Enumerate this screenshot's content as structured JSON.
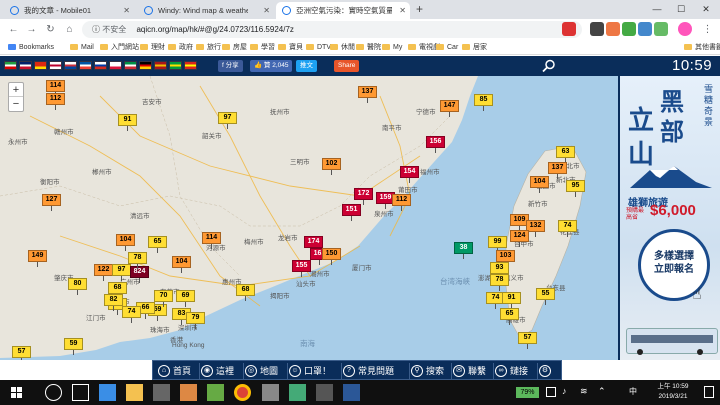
{
  "browser": {
    "tabs": [
      {
        "title": "我的文章 - Mobile01",
        "active": false
      },
      {
        "title": "Windy: Wind map & weather fo",
        "active": false
      },
      {
        "title": "亞洲空氣污染：實時空氣質量指數",
        "active": true
      }
    ],
    "new_tab": "+",
    "window_controls": {
      "minimize": "—",
      "maximize": "☐",
      "close": "✕"
    },
    "insecure_label": "不安全",
    "url": "aqicn.org/map/hk/#@g/24.0723/116.5924/7z"
  },
  "bookmarks": [
    {
      "label": "Bookmarks",
      "kind": "apps"
    },
    {
      "label": "Mail"
    },
    {
      "label": "入門網站"
    },
    {
      "label": "理財"
    },
    {
      "label": "政府"
    },
    {
      "label": "旅行"
    },
    {
      "label": "房屋"
    },
    {
      "label": "學習"
    },
    {
      "label": "寶貝"
    },
    {
      "label": "DTV"
    },
    {
      "label": "休閒"
    },
    {
      "label": "醫院"
    },
    {
      "label": "My"
    },
    {
      "label": "電視劇"
    },
    {
      "label": "Car"
    },
    {
      "label": "居家"
    },
    {
      "label": "其他書籤"
    }
  ],
  "site_header": {
    "flags": [
      {
        "name": "iran-flag",
        "colors": [
          "#239f40",
          "#ffffff",
          "#da0000"
        ]
      },
      {
        "name": "uk-flag",
        "colors": [
          "#012169",
          "#ffffff",
          "#c8102e"
        ]
      },
      {
        "name": "china-flag",
        "colors": [
          "#de2910",
          "#de2910",
          "#ffde00"
        ]
      },
      {
        "name": "japan-flag",
        "colors": [
          "#ffffff",
          "#bc002d",
          "#ffffff"
        ]
      },
      {
        "name": "korea-flag",
        "colors": [
          "#ffffff",
          "#cd2e3a",
          "#0047a0"
        ]
      },
      {
        "name": "france-flag",
        "colors": [
          "#0055a4",
          "#ffffff",
          "#ef4135"
        ]
      },
      {
        "name": "russia-flag",
        "colors": [
          "#ffffff",
          "#0039a6",
          "#d52b1e"
        ]
      },
      {
        "name": "poland-flag",
        "colors": [
          "#ffffff",
          "#ffffff",
          "#dc143c"
        ]
      },
      {
        "name": "italy-flag",
        "colors": [
          "#009246",
          "#ffffff",
          "#ce2b37"
        ]
      },
      {
        "name": "germany-flag",
        "colors": [
          "#000000",
          "#dd0000",
          "#ffce00"
        ]
      },
      {
        "name": "spain-flag",
        "colors": [
          "#aa151b",
          "#f1bf00",
          "#aa151b"
        ]
      },
      {
        "name": "brazil-flag",
        "colors": [
          "#009c3b",
          "#ffdf00",
          "#009c3b"
        ]
      },
      {
        "name": "vietnam-flag",
        "colors": [
          "#da251d",
          "#ffff00",
          "#da251d"
        ]
      }
    ],
    "fb_share": "f 分享",
    "like": "👍 贊 2,045",
    "twitter": "推文",
    "share": "Share",
    "clock": "10:59"
  },
  "map": {
    "zoom_in": "+",
    "zoom_out": "−",
    "city_labels": [
      "永州市",
      "赣州市",
      "韶关市",
      "南平市",
      "福州市",
      "宁德市",
      "龙岩市",
      "漳州市",
      "泉州市",
      "莆田市",
      "厦门市",
      "梅州市",
      "汕头市",
      "揭阳市",
      "潮州市",
      "河源市",
      "惠州市",
      "清远市",
      "肇庆市",
      "广州市",
      "佛山市",
      "东莞市",
      "深圳市",
      "中山市",
      "江门市",
      "珠海市",
      "香港",
      "Hong Kong",
      "台北市",
      "新北市",
      "桃园市",
      "新竹市",
      "台中市",
      "嘉义市",
      "台南市",
      "高雄市",
      "花莲县",
      "台东县",
      "澎湖县",
      "三明市",
      "吉安市",
      "抚州市",
      "郴州市",
      "衡阳市"
    ],
    "sea_labels": [
      "台湾海峡",
      "南海"
    ],
    "markers": [
      {
        "value": "114"
      },
      {
        "value": "112"
      },
      {
        "value": "91"
      },
      {
        "value": "97"
      },
      {
        "value": "137"
      },
      {
        "value": "147"
      },
      {
        "value": "85"
      },
      {
        "value": "102"
      },
      {
        "value": "156"
      },
      {
        "value": "151"
      },
      {
        "value": "127"
      },
      {
        "value": "172"
      },
      {
        "value": "159"
      },
      {
        "value": "154"
      },
      {
        "value": "112"
      },
      {
        "value": "104"
      },
      {
        "value": "65"
      },
      {
        "value": "149"
      },
      {
        "value": "114"
      },
      {
        "value": "174"
      },
      {
        "value": "161"
      },
      {
        "value": "155"
      },
      {
        "value": "150"
      },
      {
        "value": "122"
      },
      {
        "value": "97"
      },
      {
        "value": "824"
      },
      {
        "value": "78"
      },
      {
        "value": "104"
      },
      {
        "value": "80"
      },
      {
        "value": "68"
      },
      {
        "value": "80"
      },
      {
        "value": "59"
      },
      {
        "value": "57"
      },
      {
        "value": "59"
      },
      {
        "value": "66"
      },
      {
        "value": "83"
      },
      {
        "value": "38"
      },
      {
        "value": "63"
      },
      {
        "value": "137"
      },
      {
        "value": "104"
      },
      {
        "value": "95"
      },
      {
        "value": "109"
      },
      {
        "value": "132"
      },
      {
        "value": "124"
      },
      {
        "value": "74"
      },
      {
        "value": "99"
      },
      {
        "value": "103"
      },
      {
        "value": "93"
      },
      {
        "value": "78"
      },
      {
        "value": "74"
      },
      {
        "value": "91"
      },
      {
        "value": "55"
      },
      {
        "value": "65"
      },
      {
        "value": "57"
      },
      {
        "value": "68"
      },
      {
        "value": "70"
      },
      {
        "value": "69"
      },
      {
        "value": "79"
      },
      {
        "value": "74"
      },
      {
        "value": "82"
      }
    ]
  },
  "ad": {
    "headline": [
      "立",
      "黑",
      "山",
      "部"
    ],
    "side_text": "雪糖奇景",
    "brand": "雄獅旅遊",
    "promo_label": "預購最高省",
    "price": "$6,000",
    "bubble": [
      "多樣選擇",
      "立即報名"
    ],
    "footer": "雄獅旅遊"
  },
  "site_nav": [
    {
      "label": "首頁",
      "icon": "home-icon",
      "glyph": "⌂"
    },
    {
      "label": "這裡",
      "icon": "pin-icon",
      "glyph": "◉"
    },
    {
      "label": "地圖",
      "icon": "globe-icon",
      "glyph": "◎"
    },
    {
      "label": "口罩！",
      "icon": "mask-icon",
      "glyph": "☺"
    },
    {
      "label": "常見問題",
      "icon": "faq-icon",
      "glyph": "?"
    },
    {
      "label": "搜索",
      "icon": "search-icon",
      "glyph": "⚲"
    },
    {
      "label": "聯繫",
      "icon": "contact-icon",
      "glyph": "✉"
    },
    {
      "label": "鏈接",
      "icon": "link-icon",
      "glyph": "∞"
    },
    {
      "label": "",
      "icon": "settings-icon",
      "glyph": "⚙"
    }
  ],
  "taskbar": {
    "battery": "79%",
    "ime": "中",
    "time": "上午 10:59",
    "date": "2019/3/21"
  },
  "colors": {
    "good": "#009966",
    "moderate": "#ffde33",
    "usg": "#ff9933",
    "unhealthy": "#cc0033",
    "very_unhealthy": "#660099",
    "hazardous": "#7e0023",
    "site_header_bg": "#0a2d5a",
    "sea": "#a8cde8",
    "land": "#e8e5dc"
  }
}
